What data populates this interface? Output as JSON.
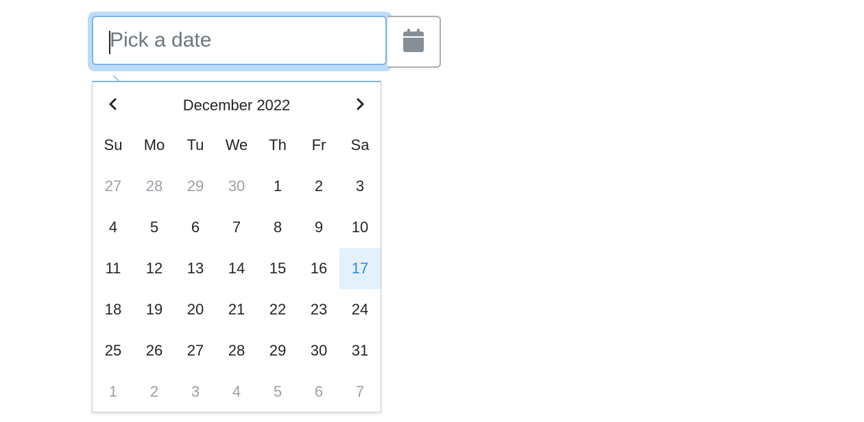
{
  "input": {
    "placeholder": "Pick a date",
    "value": ""
  },
  "calendar_button": {
    "icon": "calendar-icon"
  },
  "datepicker": {
    "title": "December 2022",
    "prev_icon": "chevron-left-icon",
    "next_icon": "chevron-right-icon",
    "weekdays": [
      "Su",
      "Mo",
      "Tu",
      "We",
      "Th",
      "Fr",
      "Sa"
    ],
    "weeks": [
      [
        "27",
        "28",
        "29",
        "30",
        "1",
        "2",
        "3"
      ],
      [
        "4",
        "5",
        "6",
        "7",
        "8",
        "9",
        "10"
      ],
      [
        "11",
        "12",
        "13",
        "14",
        "15",
        "16",
        "17"
      ],
      [
        "18",
        "19",
        "20",
        "21",
        "22",
        "23",
        "24"
      ],
      [
        "25",
        "26",
        "27",
        "28",
        "29",
        "30",
        "31"
      ],
      [
        "1",
        "2",
        "3",
        "4",
        "5",
        "6",
        "7"
      ]
    ],
    "highlighted_day": "17"
  },
  "colors": {
    "accent": "#2f8fdd",
    "focus_ring": "#bcdcf8",
    "today_bg": "#e3f1fd",
    "muted_text": "#9a9fa5"
  }
}
